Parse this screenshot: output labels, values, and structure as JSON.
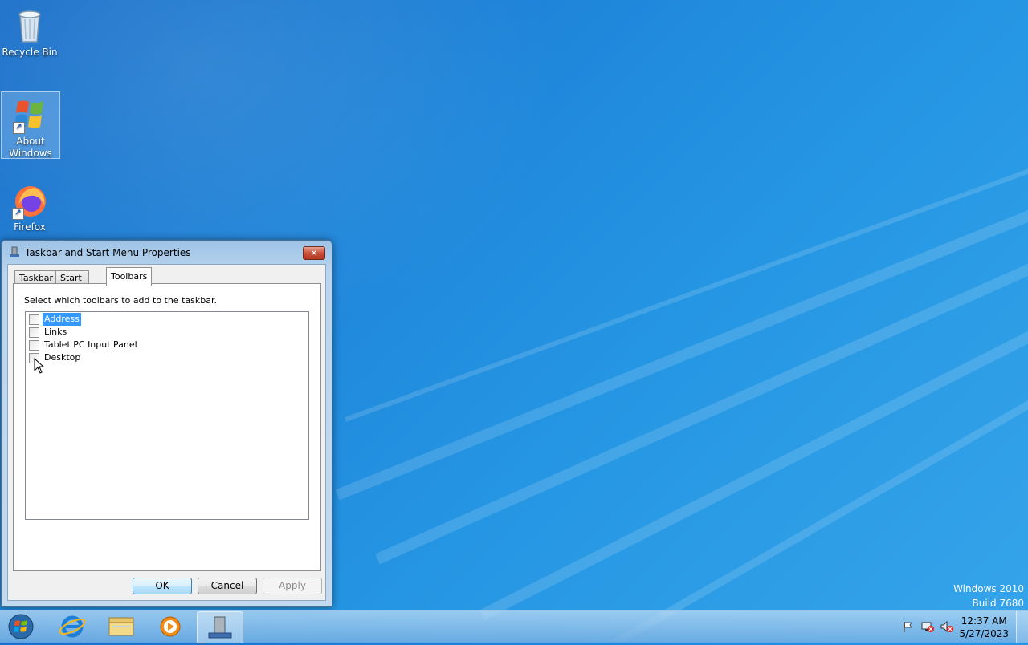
{
  "desktop": {
    "icons": [
      {
        "label": "Recycle Bin"
      },
      {
        "label": "About Windows"
      },
      {
        "label": "Firefox"
      }
    ],
    "watermark": {
      "line1": "Windows 2010",
      "line2": "Build 7680"
    }
  },
  "dialog": {
    "title": "Taskbar and Start Menu Properties",
    "close_glyph": "✕",
    "tabs": [
      {
        "label": "Taskbar"
      },
      {
        "label": "Start Menu"
      },
      {
        "label": "Toolbars",
        "active": true
      }
    ],
    "instruction": "Select which toolbars to add to the taskbar.",
    "toolbars": [
      {
        "label": "Address",
        "checked": false,
        "selected": true
      },
      {
        "label": "Links",
        "checked": false
      },
      {
        "label": "Tablet PC Input Panel",
        "checked": false
      },
      {
        "label": "Desktop",
        "checked": false
      }
    ],
    "buttons": {
      "ok": "OK",
      "cancel": "Cancel",
      "apply": "Apply"
    }
  },
  "taskbar": {
    "pinned": [
      "start-orb",
      "internet-explorer",
      "file-explorer",
      "media-player",
      "taskbar-properties"
    ],
    "active_item": "taskbar-properties",
    "tray_icons": [
      "action-center-flag-icon",
      "network-icon",
      "volume-muted-icon"
    ],
    "clock": {
      "time": "12:37 AM",
      "date": "5/27/2023"
    }
  }
}
